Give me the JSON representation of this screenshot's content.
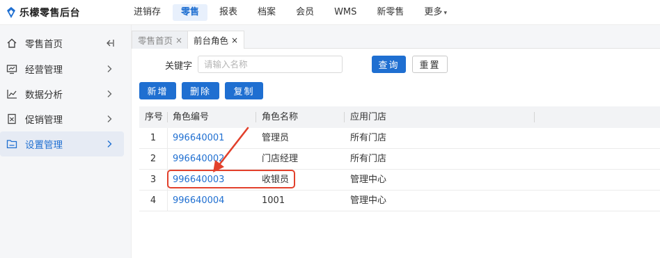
{
  "brand": {
    "name": "乐檬零售后台",
    "logo_icon": "lemon-logo-icon",
    "accent": "#1f6fd1"
  },
  "nav": [
    {
      "label": "进销存"
    },
    {
      "label": "零售",
      "active": true
    },
    {
      "label": "报表"
    },
    {
      "label": "档案"
    },
    {
      "label": "会员"
    },
    {
      "label": "WMS"
    },
    {
      "label": "新零售"
    },
    {
      "label": "更多",
      "caret": "▾"
    }
  ],
  "sidebar": {
    "items": [
      {
        "label": "零售首页",
        "icon": "home-icon"
      },
      {
        "label": "经营管理",
        "icon": "monitor-icon"
      },
      {
        "label": "数据分析",
        "icon": "chart-icon"
      },
      {
        "label": "促销管理",
        "icon": "tag-icon"
      },
      {
        "label": "设置管理",
        "icon": "folder-icon",
        "active": true
      }
    ]
  },
  "tabs": [
    {
      "label": "零售首页",
      "close": "×"
    },
    {
      "label": "前台角色",
      "close": "×",
      "active": true
    }
  ],
  "search": {
    "label": "关键字",
    "placeholder": "请输入名称",
    "query_button": "查询",
    "reset_button": "重置"
  },
  "actions": {
    "add": "新增",
    "delete": "删除",
    "copy": "复制"
  },
  "table": {
    "headers": {
      "idx": "序号",
      "code": "角色编号",
      "name": "角色名称",
      "store": "应用门店"
    },
    "rows": [
      {
        "idx": "1",
        "code": "996640001",
        "name": "管理员",
        "store": "所有门店"
      },
      {
        "idx": "2",
        "code": "996640002",
        "name": "门店经理",
        "store": "所有门店"
      },
      {
        "idx": "3",
        "code": "996640003",
        "name": "收银员",
        "store": "管理中心"
      },
      {
        "idx": "4",
        "code": "996640004",
        "name": "1001",
        "store": "管理中心"
      }
    ]
  },
  "annotation": {
    "color": "#e2402b",
    "highlighted_row": 3
  }
}
